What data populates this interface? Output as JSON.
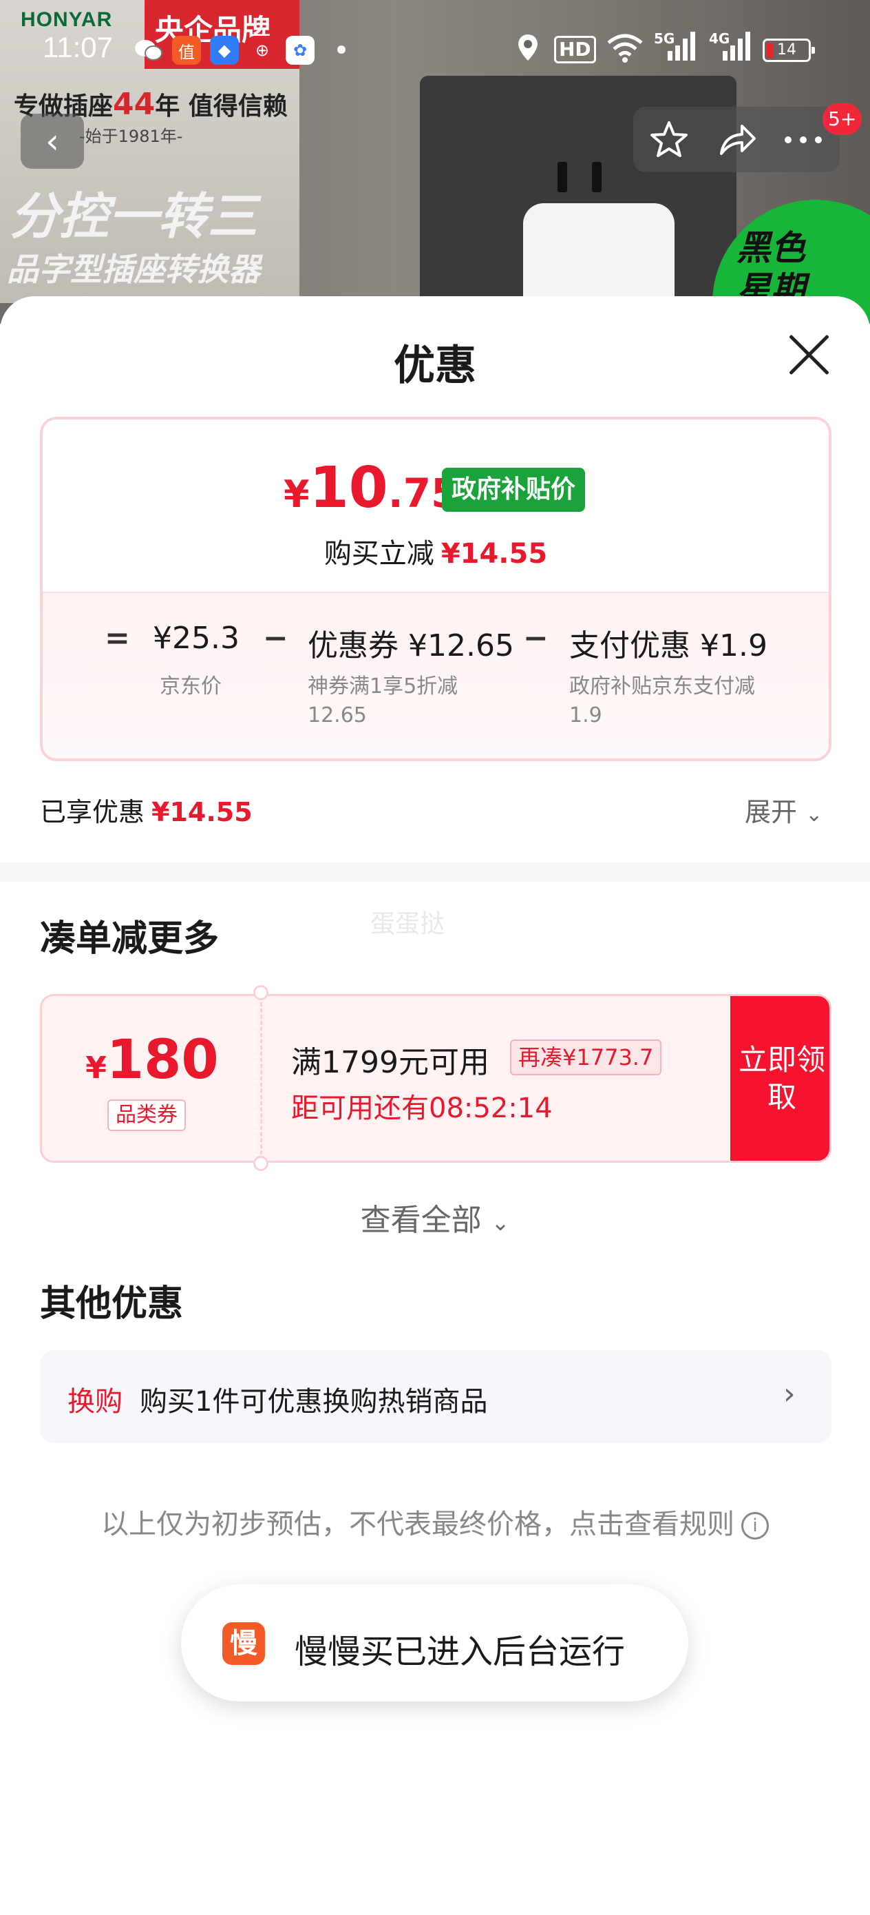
{
  "banner": {
    "brand": "HONYAR",
    "central_badge": "央企品牌",
    "slogan_prefix": "专做插座",
    "slogan_number": "44",
    "slogan_suffix": "年 值得信赖",
    "since": "-始于1981年-",
    "headline1": "分控一转三",
    "headline2": "品字型插座转换器",
    "promo": "黑色星期五"
  },
  "status_bar": {
    "time": "11:07",
    "signal_5g": "5G",
    "signal_4g": "4G",
    "hd": "HD",
    "battery": "14"
  },
  "nav": {
    "back_icon": "chevron-left-icon",
    "badge": "5+"
  },
  "sheet": {
    "title": "优惠",
    "price": {
      "currency": "¥",
      "integer": "10",
      "decimal": ".75",
      "tag": "政府补贴价",
      "reduce_label": "购买立减",
      "reduce_amount": "¥14.55"
    },
    "calc": {
      "equals": "=",
      "minus": "−",
      "jd_price": "¥25.3",
      "jd_label": "京东价",
      "coupon": "优惠券 ¥12.65",
      "coupon_desc": "神券满1享5折减12.65",
      "payment": "支付优惠 ¥1.9",
      "payment_desc": "政府补贴京东支付减1.9"
    },
    "enjoyed_label": "已享优惠",
    "enjoyed_amount": "¥14.55",
    "expand_label": "展开"
  },
  "more": {
    "title": "凑单减更多",
    "watermark": "蛋蛋挞",
    "coupon": {
      "currency": "¥",
      "amount": "180",
      "type": "品类券",
      "condition": "满1799元可用",
      "tag": "再凑¥1773.7",
      "timer": "距可用还有08:52:14",
      "claim": "立即领取"
    },
    "view_all": "查看全部"
  },
  "other": {
    "title": "其他优惠",
    "exchange_tag": "换购",
    "exchange_text": "购买1件可优惠换购热销商品"
  },
  "disclaimer": "以上仅为初步预估，不代表最终价格，点击查看规则",
  "toast": {
    "icon_text": "慢",
    "text": "慢慢买已进入后台运行"
  },
  "colors": {
    "accent_red": "#e8192c",
    "claim_red": "#f5132f",
    "gov_green": "#1aa33a"
  }
}
